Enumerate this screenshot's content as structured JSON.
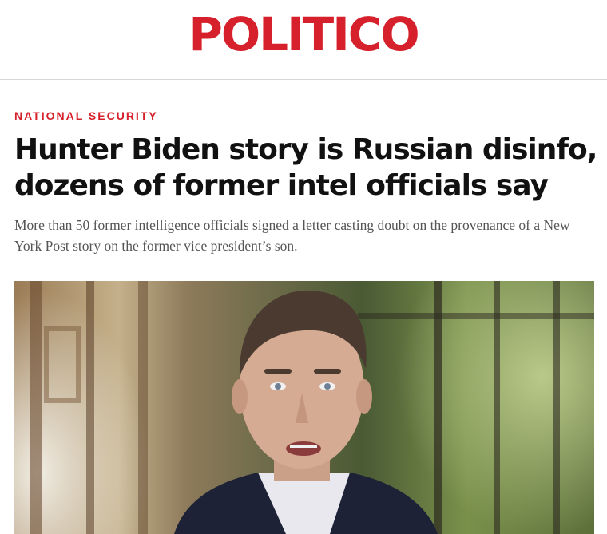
{
  "masthead": {
    "logo_text": "POLITICO",
    "brand_color": "#d6202b"
  },
  "article": {
    "kicker": "NATIONAL SECURITY",
    "kicker_color": "#d6202b",
    "headline": "Hunter Biden story is Russian disinfo, dozens of former intel officials say",
    "dek": "More than 50 former intelligence officials signed a letter casting doubt on the provenance of a New York Post story on the former vice president’s son."
  }
}
